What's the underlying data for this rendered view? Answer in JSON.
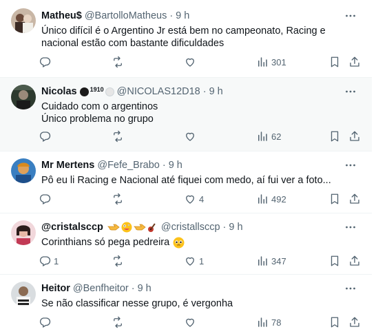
{
  "tweets": [
    {
      "name": "Matheu$",
      "handle": "@BartolloMatheus",
      "separator": "·",
      "time": "9 h",
      "text": "Único difícil é o Argentino Jr está bem no campeonato, Racing e nacional estão com bastante dificuldades",
      "replies": "",
      "retweets": "",
      "likes": "",
      "views": "301"
    },
    {
      "name": "Nicolas",
      "name_extra": "1910",
      "handle": "@NICOLAS12D18",
      "separator": "·",
      "time": "9 h",
      "text": "Cuidado com o argentinos\nÚnico problema no grupo",
      "replies": "",
      "retweets": "",
      "likes": "",
      "views": "62"
    },
    {
      "name": "Mr Mertens",
      "handle": "@Fefe_Brabo",
      "separator": "·",
      "time": "9 h",
      "text": "Pô eu li Racing e Nacional até fiquei com medo, aí fui ver a foto...",
      "replies": "",
      "retweets": "",
      "likes": "4",
      "views": "492"
    },
    {
      "name": "@cristalsccp",
      "handle": "@cristallsccp",
      "separator": "·",
      "time": "9 h",
      "text": "Corinthians só pega pedreira",
      "replies": "1",
      "retweets": "",
      "likes": "1",
      "views": "347"
    },
    {
      "name": "Heitor",
      "handle": "@Benfheitor",
      "separator": "·",
      "time": "9 h",
      "text": "Se não classificar nesse grupo, é vergonha",
      "replies": "",
      "retweets": "",
      "likes": "",
      "views": "78"
    }
  ],
  "colors": {
    "text": "#0f1419",
    "secondary": "#536471",
    "divider": "#eff3f4",
    "highlight_bg": "#f7f9f9"
  },
  "icons": {
    "more": "more-icon",
    "reply": "reply-icon",
    "retweet": "retweet-icon",
    "like": "like-icon",
    "views": "views-icon",
    "bookmark": "bookmark-icon",
    "share": "share-icon"
  }
}
